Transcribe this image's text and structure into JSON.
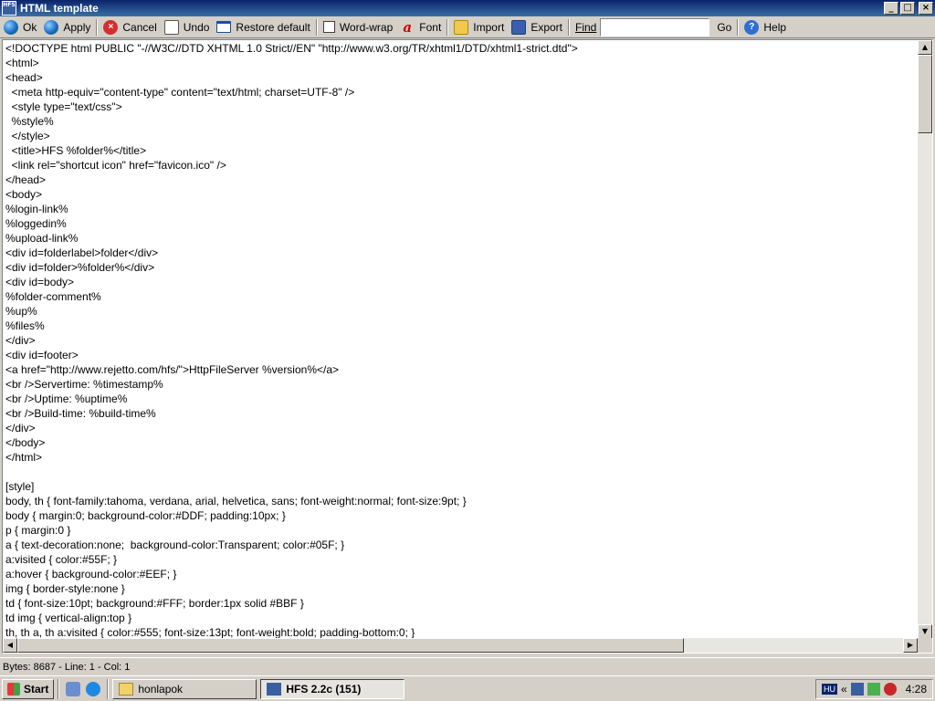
{
  "window": {
    "app_icon_text": "HFS",
    "title": "HTML template"
  },
  "toolbar": {
    "ok": "Ok",
    "apply": "Apply",
    "cancel": "Cancel",
    "undo": "Undo",
    "restore_default": "Restore default",
    "word_wrap": "Word-wrap",
    "font": "Font",
    "import": "Import",
    "export": "Export",
    "find_label": "Find",
    "find_value": "",
    "go": "Go",
    "help": "Help"
  },
  "editor": {
    "lines": [
      "<!DOCTYPE html PUBLIC \"-//W3C//DTD XHTML 1.0 Strict//EN\" \"http://www.w3.org/TR/xhtml1/DTD/xhtml1-strict.dtd\">",
      "<html>",
      "<head>",
      "  <meta http-equiv=\"content-type\" content=\"text/html; charset=UTF-8\" />",
      "  <style type=\"text/css\">",
      "  %style%",
      "  </style>",
      "  <title>HFS %folder%</title>",
      "  <link rel=\"shortcut icon\" href=\"favicon.ico\" />",
      "</head>",
      "<body>",
      "%login-link%",
      "%loggedin%",
      "%upload-link%",
      "<div id=folderlabel>folder</div>",
      "<div id=folder>%folder%</div>",
      "<div id=body>",
      "%folder-comment%",
      "%up%",
      "%files%",
      "</div>",
      "<div id=footer>",
      "<a href=\"http://www.rejetto.com/hfs/\">HttpFileServer %version%</a>",
      "<br />Servertime: %timestamp%",
      "<br />Uptime: %uptime%",
      "<br />Build-time: %build-time%",
      "</div>",
      "</body>",
      "</html>",
      "",
      "[style]",
      "body, th { font-family:tahoma, verdana, arial, helvetica, sans; font-weight:normal; font-size:9pt; }",
      "body { margin:0; background-color:#DDF; padding:10px; }",
      "p { margin:0 }",
      "a { text-decoration:none;  background-color:Transparent; color:#05F; }",
      "a:visited { color:#55F; }",
      "a:hover { background-color:#EEF; }",
      "img { border-style:none }",
      "td { font-size:10pt; background:#FFF; border:1px solid #BBF }",
      "td img { vertical-align:top }",
      "th, th a, th a:visited { color:#555; font-size:13pt; font-weight:bold; padding-bottom:0; }"
    ]
  },
  "statusbar": {
    "text": "Bytes: 8687 - Line: 1 - Col: 1"
  },
  "taskbar": {
    "start": "Start",
    "tasks": [
      "honlapok",
      "HFS 2.2c (151)"
    ],
    "tray_lang": "HU",
    "tray_chevron": "«",
    "clock": "4:28"
  }
}
